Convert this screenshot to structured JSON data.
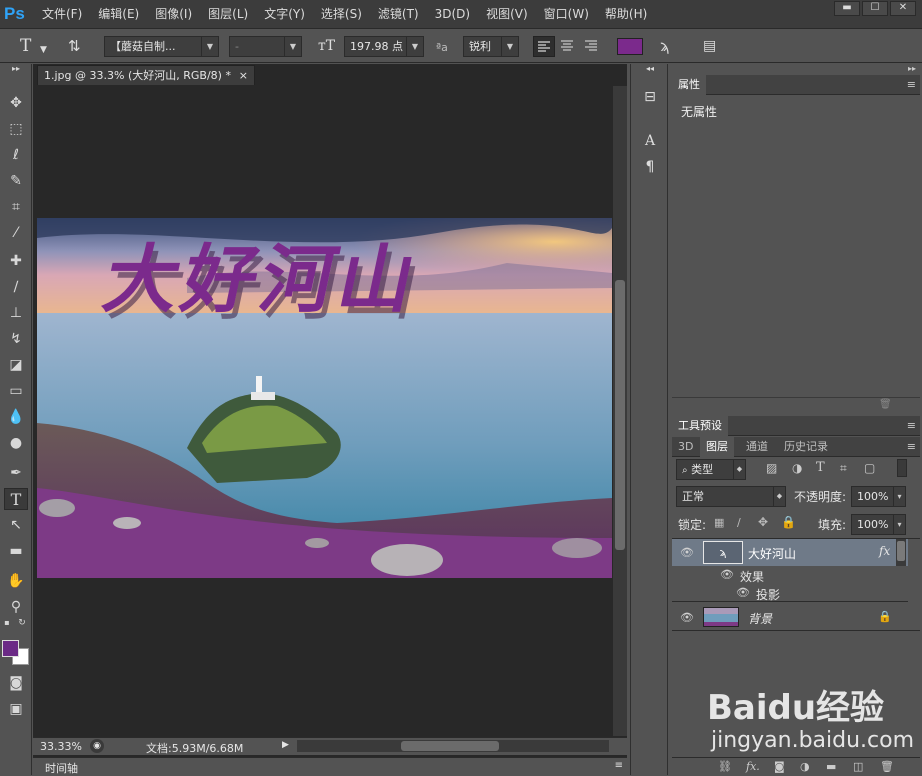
{
  "app": {
    "logo": "Ps"
  },
  "menu": [
    "文件(F)",
    "编辑(E)",
    "图像(I)",
    "图层(L)",
    "文字(Y)",
    "选择(S)",
    "滤镜(T)",
    "3D(D)",
    "视图(V)",
    "窗口(W)",
    "帮助(H)"
  ],
  "window_controls": {
    "minimize": "▬",
    "maximize": "☐",
    "close": "✕"
  },
  "options": {
    "font_family": "【蘑菇自制...",
    "font_style": "-",
    "font_size": "197.98 点",
    "aa_label": "ªa",
    "antialias": "锐利",
    "text_color": "#7b2a8c"
  },
  "document": {
    "tab_title": "1.jpg @ 33.3% (大好河山, RGB/8) *",
    "tab_close": "×",
    "artwork_text": "大好河山",
    "zoom": "33.33%",
    "doc_info": "文档:5.93M/6.68M",
    "timeline_label": "时间轴"
  },
  "panels": {
    "properties": {
      "title": "属性",
      "content": "无属性"
    },
    "tool_presets": {
      "title": "工具预设"
    },
    "tabs": [
      "3D",
      "图层",
      "通道",
      "历史记录"
    ],
    "active_tab": "图层",
    "filter_kind": "类型",
    "blend_mode": "正常",
    "opacity_label": "不透明度:",
    "opacity_value": "100%",
    "lock_label": "锁定:",
    "fill_label": "填充:",
    "fill_value": "100%"
  },
  "layers": [
    {
      "name": "大好河山",
      "fx": "fx",
      "effects_label": "效果",
      "effect": "投影"
    },
    {
      "name": "背景"
    }
  ],
  "colors": {
    "foreground": "#6b2a86",
    "background": "#ffffff",
    "accent": "#2fa3f7"
  },
  "watermark": {
    "brand": "Baidu经验",
    "url": "jingyan.baidu.com"
  }
}
